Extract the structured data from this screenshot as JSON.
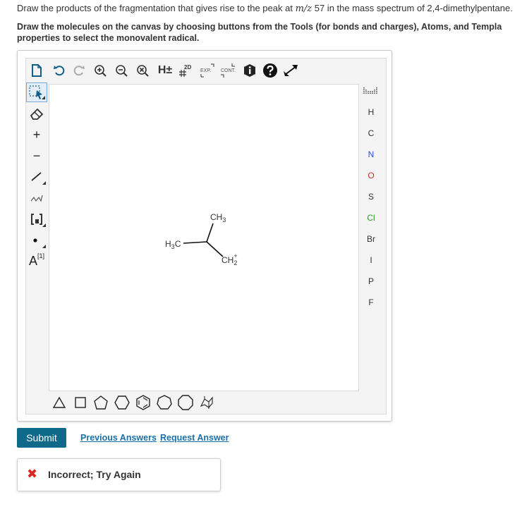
{
  "question": {
    "prefix": "Draw the products of the fragmentation that gives rise to the peak at ",
    "mz": "m/z",
    "suffix": " 57 in the mass spectrum of 2,4-dimethylpentane."
  },
  "instructions": {
    "line1": "Draw the molecules on the canvas by choosing buttons from the Tools (for bonds and charges), Atoms, and Templa",
    "line2": "properties to select the monovalent radical."
  },
  "toolbar": {
    "h_label": "H±",
    "exp_label": "EXP.",
    "cont_label": "CONT.",
    "twod_label": "2D"
  },
  "left_tools": {
    "plus": "+",
    "minus": "−",
    "atom_label": "A",
    "atom_index": "[1]"
  },
  "atoms": [
    {
      "symbol": "H",
      "color": "#333333"
    },
    {
      "symbol": "C",
      "color": "#333333"
    },
    {
      "symbol": "N",
      "color": "#2a4fd6"
    },
    {
      "symbol": "O",
      "color": "#d42a2a"
    },
    {
      "symbol": "S",
      "color": "#333333"
    },
    {
      "symbol": "Cl",
      "color": "#2a9a2a"
    },
    {
      "symbol": "Br",
      "color": "#333333"
    },
    {
      "symbol": "I",
      "color": "#333333"
    },
    {
      "symbol": "P",
      "color": "#333333"
    },
    {
      "symbol": "F",
      "color": "#333333"
    }
  ],
  "molecule": {
    "top_label": "CH",
    "top_sub": "3",
    "left_label": "H",
    "left_sub": "3",
    "left_label2": "C",
    "right_label": "CH",
    "right_sub": "2",
    "right_sup": "+"
  },
  "actions": {
    "submit": "Submit",
    "previous": "Previous Answers",
    "request": "Request Answer"
  },
  "feedback": {
    "icon": "✖",
    "message": "Incorrect; Try Again",
    "color": "#dd2222"
  }
}
